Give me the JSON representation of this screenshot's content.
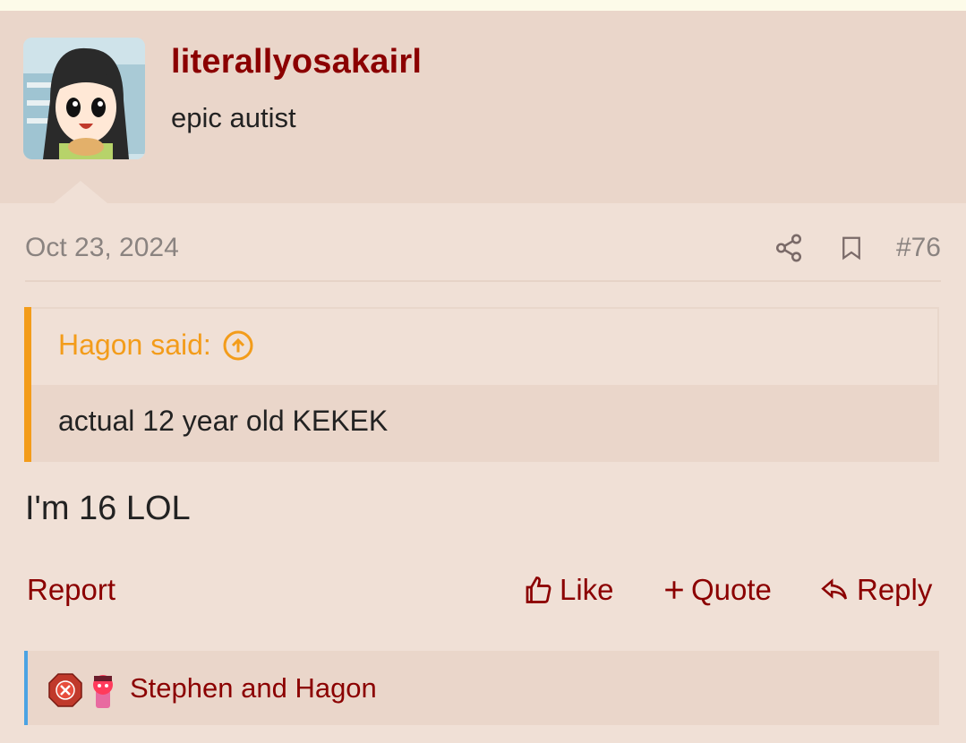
{
  "post": {
    "author": {
      "username": "literallyosakairl",
      "title": "epic autist"
    },
    "date": "Oct 23, 2024",
    "post_number": "#76",
    "quote": {
      "attribution": "Hagon said:",
      "text": "actual 12 year old KEKEK"
    },
    "body": "I'm 16 LOL",
    "actions": {
      "report": "Report",
      "like": "Like",
      "quote": "Quote",
      "reply": "Reply"
    },
    "reactions": {
      "text": "Stephen and Hagon"
    },
    "icons": {
      "share": "share-icon",
      "bookmark": "bookmark-icon",
      "quote_jump": "arrow-up-circle-icon",
      "like": "thumbs-up-icon",
      "quote_add": "plus-icon",
      "reply": "reply-icon"
    },
    "colors": {
      "username": "#8b0000",
      "quote_accent": "#f39c1a",
      "reaction_accent": "#4ba3e3"
    }
  }
}
